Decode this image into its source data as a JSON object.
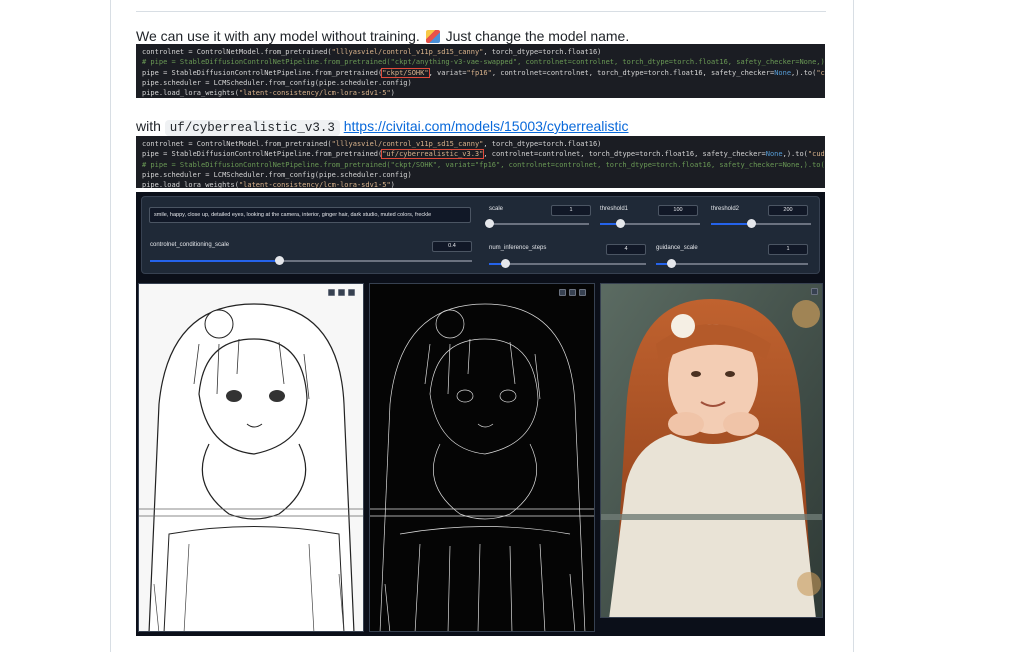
{
  "intro": {
    "text": "We can use it with any model without training.",
    "emoji_icon": "emoji-icon",
    "text_after": "Just change the model name."
  },
  "code1": {
    "lines": [
      "controlnet = ControlNetModel.from_pretrained(\"lllyasviel/control_v11p_sd15_canny\", torch_dtype=torch.float16)",
      "# pipe = StableDiffusionControlNetPipeline.from_pretrained(\"ckpt/anything-v3-vae-swapped\", controlnet=controlnet, torch_dtype=torch.float16, safety_checker=None,).to(\"cuda\")",
      "pipe = StableDiffusionControlNetPipeline.from_pretrained(\"ckpt/SOHK\", variat=\"fp16\", controlnet=controlnet, torch_dtype=torch.float16, safety_checker=None,).to(\"cuda\")",
      "pipe.scheduler = LCMScheduler.from_config(pipe.scheduler.config)",
      "pipe.load_lora_weights(\"latent-consistency/lcm-lora-sdv1-5\")"
    ]
  },
  "with_line": {
    "prefix": "with",
    "model_code": "uf/cyberrealistic_v3.3",
    "link": "https://civitai.com/models/15003/cyberrealistic"
  },
  "code2": {
    "lines": [
      "controlnet = ControlNetModel.from_pretrained(\"lllyasviel/control_v11p_sd15_canny\", torch_dtype=torch.float16)",
      "pipe = StableDiffusionControlNetPipeline.from_pretrained(\"uf/cyberrealistic_v3.3\", controlnet=controlnet, torch_dtype=torch.float16, safety_checker=None,).to(\"cuda\")",
      "# pipe = StableDiffusionControlNetPipeline.from_pretrained(\"ckpt/SOHK\", variat=\"fp16\", controlnet=controlnet, torch_dtype=torch.float16, safety_checker=None,).to(\"cuda\")",
      "pipe.scheduler = LCMScheduler.from_config(pipe.scheduler.config)",
      "pipe.load_lora_weights(\"latent-consistency/lcm-lora-sdv1-5\")"
    ]
  },
  "app": {
    "prompt": "smile, happy, close up, detailed eyes, looking at the camera, interior, ginger hair, dark studio, muted colors, freckle",
    "controls": {
      "scale": {
        "label": "scale",
        "value": "1",
        "fraction": 0.0
      },
      "threshold1": {
        "label": "threshold1",
        "value": "100",
        "fraction": 0.2
      },
      "threshold2": {
        "label": "threshold2",
        "value": "200",
        "fraction": 0.4
      },
      "conditioning": {
        "label": "controlnet_conditioning_scale",
        "value": "0.4",
        "fraction": 0.4
      },
      "steps": {
        "label": "num_inference_steps",
        "value": "4",
        "fraction": 0.1
      },
      "guidance": {
        "label": "guidance_scale",
        "value": "1",
        "fraction": 0.1
      }
    },
    "images": {
      "input": "input-sketch-image",
      "canny": "canny-edge-image",
      "output": "generated-photo-image"
    }
  }
}
